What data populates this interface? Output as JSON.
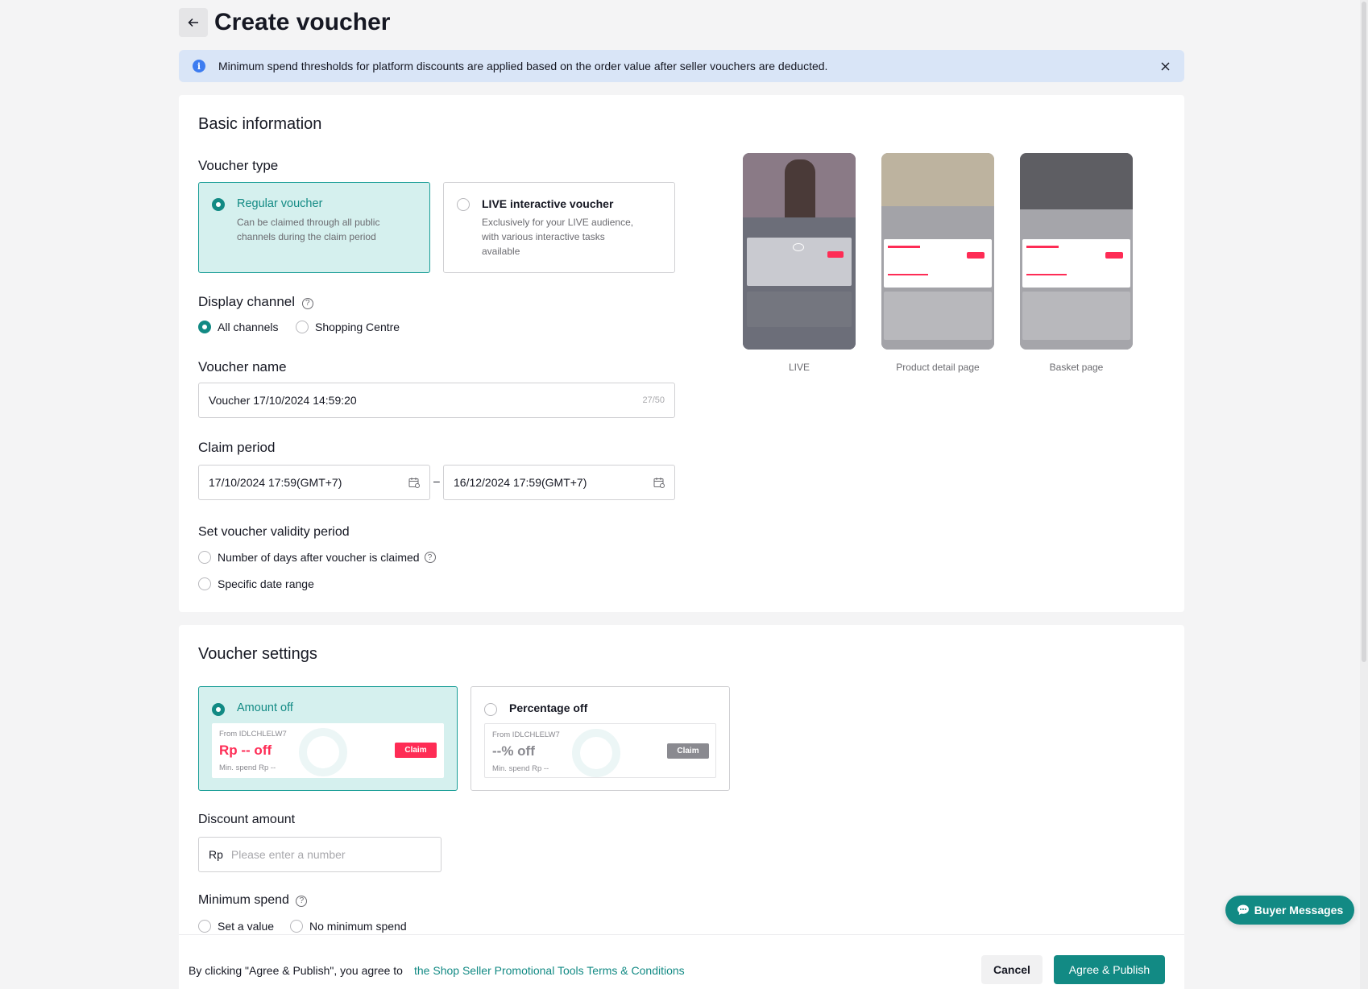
{
  "page": {
    "title": "Create voucher"
  },
  "banner": {
    "text": "Minimum spend thresholds for platform discounts are applied based on the order value after seller vouchers are deducted."
  },
  "basic": {
    "title": "Basic information",
    "voucher_type_label": "Voucher type",
    "types": [
      {
        "title": "Regular voucher",
        "desc1": "Can be claimed through all public",
        "desc2": "channels during the claim period",
        "desc3": "",
        "selected": true
      },
      {
        "title": "LIVE interactive voucher",
        "desc1": "Exclusively for your LIVE audience,",
        "desc2": "with various interactive tasks",
        "desc3": "available",
        "selected": false
      }
    ],
    "display_channel_label": "Display channel",
    "channels": [
      {
        "label": "All channels",
        "selected": true
      },
      {
        "label": "Shopping Centre",
        "selected": false
      }
    ],
    "voucher_name_label": "Voucher name",
    "voucher_name_value": "Voucher 17/10/2024 14:59:20",
    "voucher_name_count": "27/50",
    "claim_period_label": "Claim period",
    "claim_start": "17/10/2024 17:59(GMT+7)",
    "claim_end": "16/12/2024 17:59(GMT+7)",
    "claim_separator": "–",
    "validity_label": "Set voucher validity period",
    "validity_options": [
      {
        "label": "Number of days after voucher is claimed"
      },
      {
        "label": "Specific date range"
      }
    ],
    "previews": [
      {
        "caption": "LIVE"
      },
      {
        "caption": "Product detail page"
      },
      {
        "caption": "Basket page"
      }
    ]
  },
  "settings": {
    "title": "Voucher settings",
    "types": [
      {
        "title": "Amount off",
        "from": "From IDLCHLELW7",
        "value": "Rp -- off",
        "min": "Min. spend Rp --",
        "claim": "Claim",
        "selected": true
      },
      {
        "title": "Percentage off",
        "from": "From IDLCHLELW7",
        "value": "--% off",
        "min": "Min. spend Rp --",
        "claim": "Claim",
        "selected": false
      }
    ],
    "discount_label": "Discount amount",
    "discount_prefix": "Rp",
    "discount_placeholder": "Please enter a number",
    "min_spend_label": "Minimum spend",
    "min_spend_options": [
      {
        "label": "Set a value"
      },
      {
        "label": "No minimum spend"
      }
    ]
  },
  "footer": {
    "agree_text": "By clicking \"Agree & Publish\", you agree to",
    "terms_link": "the Shop Seller Promotional Tools Terms & Conditions",
    "cancel": "Cancel",
    "publish": "Agree & Publish"
  },
  "chat": {
    "label": "Buyer Messages"
  },
  "colors": {
    "accent": "#128a84",
    "accent_bg": "#d5f0ee",
    "banner_bg": "#d9e5f7",
    "claim_red": "#fe2c55"
  }
}
